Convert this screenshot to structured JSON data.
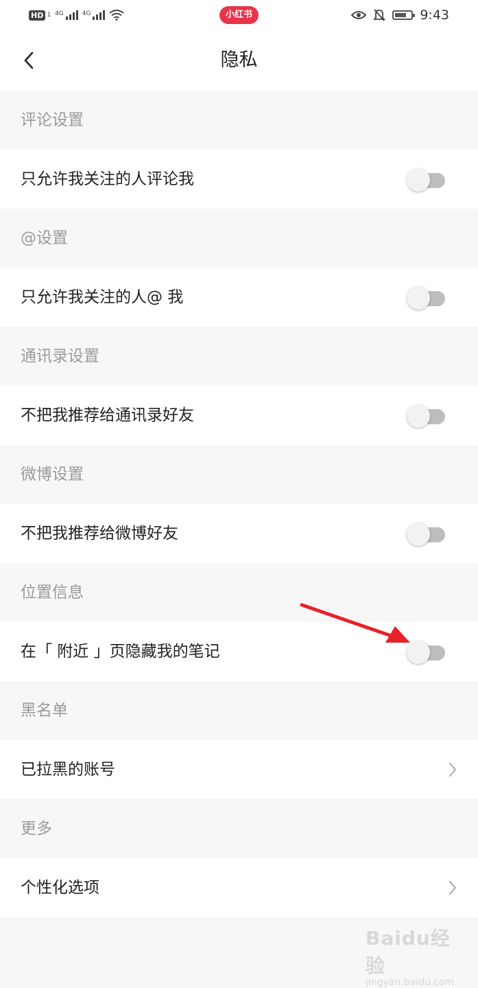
{
  "status_bar": {
    "hd_label": "HD",
    "hd_sub": "1",
    "network_1": "4G",
    "network_2": "4G",
    "brand": "小红书",
    "time": "9:43"
  },
  "nav": {
    "title": "隐私",
    "back_icon": "chevron-left-icon"
  },
  "sections": [
    {
      "header": "评论设置",
      "item": "只允许我关注的人评论我",
      "control": "toggle",
      "enabled": false
    },
    {
      "header": "@设置",
      "item": "只允许我关注的人@ 我",
      "control": "toggle",
      "enabled": false
    },
    {
      "header": "通讯录设置",
      "item": "不把我推荐给通讯录好友",
      "control": "toggle",
      "enabled": false
    },
    {
      "header": "微博设置",
      "item": "不把我推荐给微博好友",
      "control": "toggle",
      "enabled": false
    },
    {
      "header": "位置信息",
      "item": "在「 附近 」页隐藏我的笔记",
      "control": "toggle",
      "enabled": false
    },
    {
      "header": "黑名单",
      "item": "已拉黑的账号",
      "control": "chevron"
    },
    {
      "header": "更多",
      "item": "个性化选项",
      "control": "chevron"
    }
  ],
  "annotation": {
    "arrow_color": "#e8222a"
  },
  "watermark": {
    "logo": "Baidu经验",
    "sub": "jingyan.baidu.com"
  },
  "colors": {
    "accent": "#e8334a",
    "background": "#f7f7f7",
    "header_text": "#9a9a9a",
    "toggle_off_track": "#bdbdbd"
  }
}
